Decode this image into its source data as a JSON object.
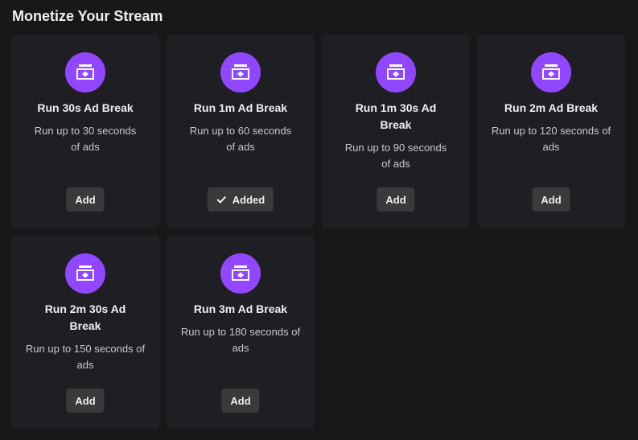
{
  "page": {
    "title": "Monetize Your Stream"
  },
  "colors": {
    "background": "#18181b",
    "card": "#1f1f23",
    "accent": "#9146ff",
    "button": "#3a3a3d",
    "text": "#efeff1"
  },
  "cards": [
    {
      "icon": "ad-ticket-icon",
      "title": "Run 30s Ad Break",
      "description": "Run up to 30 seconds of ads",
      "button": "Add",
      "added": false
    },
    {
      "icon": "ad-ticket-icon",
      "title": "Run 1m Ad Break",
      "description": "Run up to 60 seconds of ads",
      "button": "Added",
      "added": true
    },
    {
      "icon": "ad-ticket-icon",
      "title": "Run 1m 30s Ad Break",
      "description": "Run up to 90 seconds of ads",
      "button": "Add",
      "added": false
    },
    {
      "icon": "ad-ticket-icon",
      "title": "Run 2m Ad Break",
      "description": "Run up to 120 seconds of ads",
      "button": "Add",
      "added": false
    },
    {
      "icon": "ad-ticket-icon",
      "title": "Run 2m 30s Ad Break",
      "description": "Run up to 150 seconds of ads",
      "button": "Add",
      "added": false
    },
    {
      "icon": "ad-ticket-icon",
      "title": "Run 3m Ad Break",
      "description": "Run up to 180 seconds of ads",
      "button": "Add",
      "added": false
    }
  ]
}
